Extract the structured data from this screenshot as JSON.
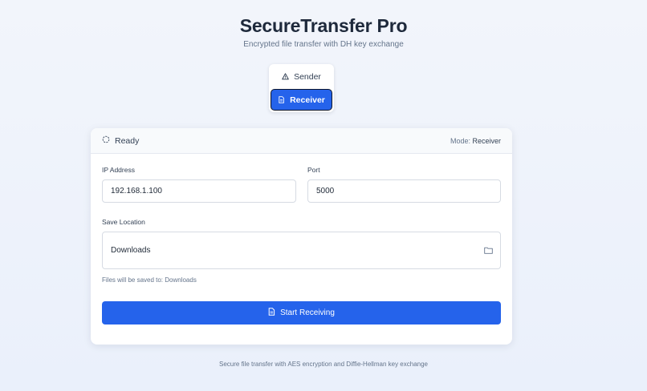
{
  "app": {
    "title": "SecureTransfer Pro",
    "subtitle": "Encrypted file transfer with DH key exchange"
  },
  "mode_switch": {
    "sender_label": "Sender",
    "sender_icon": "warning-triangle-icon",
    "receiver_label": "Receiver",
    "receiver_icon": "document-icon",
    "selected": "Receiver"
  },
  "status": {
    "icon": "status-circle-icon",
    "text": "Ready",
    "mode_prefix": "Mode:",
    "mode_value": "Receiver"
  },
  "form": {
    "ip_label": "IP Address",
    "ip_value": "192.168.1.100",
    "port_label": "Port",
    "port_value": "5000",
    "save_label": "Save Location",
    "save_value": "Downloads",
    "save_icon": "folder-icon",
    "save_hint": "Files will be saved to: Downloads"
  },
  "action": {
    "label": "Start Receiving",
    "icon": "document-icon"
  },
  "footer": {
    "text": "Secure file transfer with AES encryption and Diffie-Hellman key exchange"
  },
  "colors": {
    "accent": "#2563eb",
    "title": "#1e293b",
    "muted": "#64748b"
  }
}
